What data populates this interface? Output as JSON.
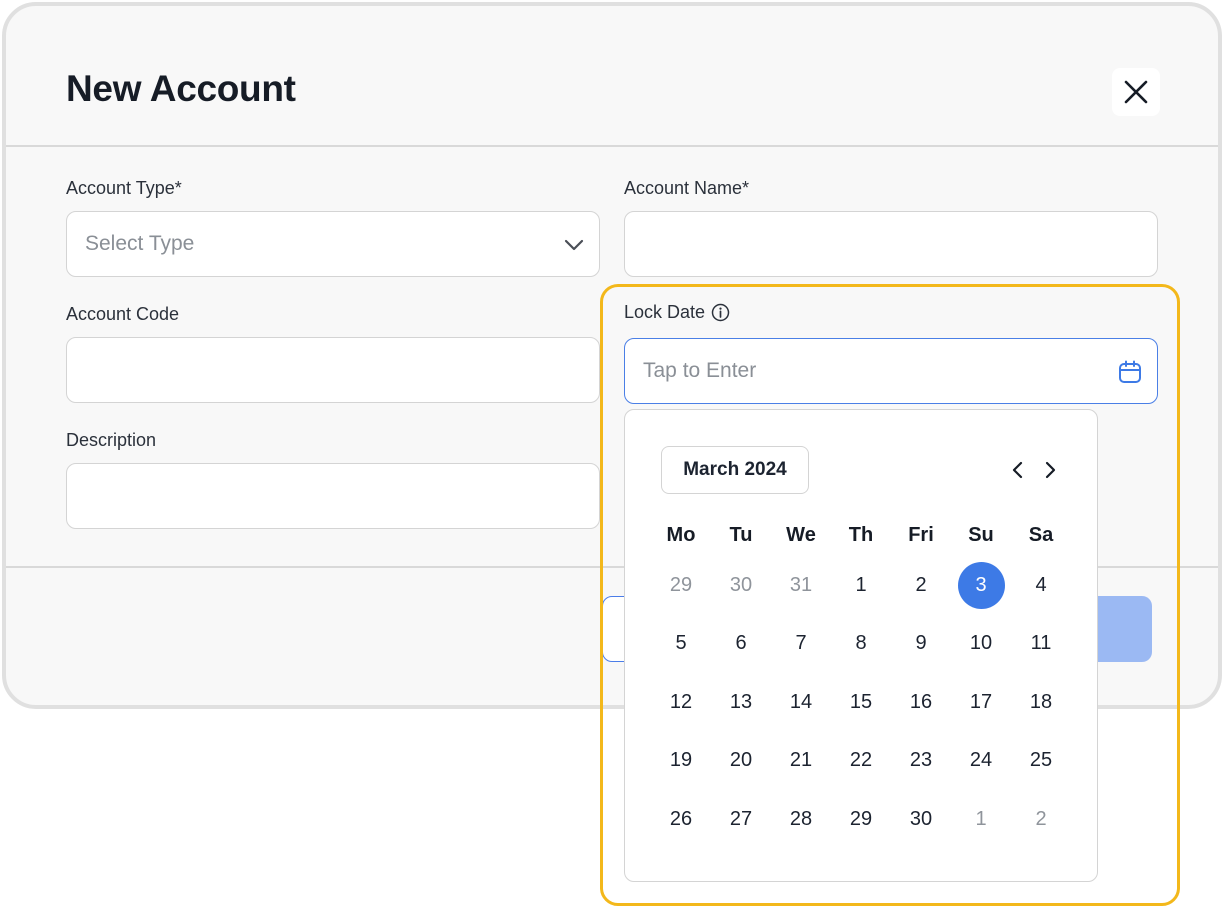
{
  "dialog": {
    "title": "New Account",
    "close_icon": "close-icon"
  },
  "form": {
    "account_type": {
      "label": "Account Type*",
      "placeholder": "Select Type",
      "icon": "chevron-down-icon"
    },
    "account_name": {
      "label": "Account Name*",
      "value": ""
    },
    "account_code": {
      "label": "Account Code",
      "value": ""
    },
    "description": {
      "label": "Description",
      "value": ""
    },
    "lock_date": {
      "label": "Lock Date",
      "info_icon": "info-icon",
      "placeholder": "Tap to Enter",
      "icon": "calendar-icon"
    }
  },
  "calendar": {
    "month_label": "March 2024",
    "prev_icon": "chevron-left-icon",
    "next_icon": "chevron-right-icon",
    "weekdays": [
      "Mo",
      "Tu",
      "We",
      "Th",
      "Fri",
      "Su",
      "Sa"
    ],
    "weeks": [
      [
        {
          "d": "29",
          "m": true
        },
        {
          "d": "30",
          "m": true
        },
        {
          "d": "31",
          "m": true
        },
        {
          "d": "1"
        },
        {
          "d": "2"
        },
        {
          "d": "3",
          "s": true
        },
        {
          "d": "4"
        }
      ],
      [
        {
          "d": "5"
        },
        {
          "d": "6"
        },
        {
          "d": "7"
        },
        {
          "d": "8"
        },
        {
          "d": "9"
        },
        {
          "d": "10"
        },
        {
          "d": "11"
        }
      ],
      [
        {
          "d": "12"
        },
        {
          "d": "13"
        },
        {
          "d": "14"
        },
        {
          "d": "15"
        },
        {
          "d": "16"
        },
        {
          "d": "17"
        },
        {
          "d": "18"
        }
      ],
      [
        {
          "d": "19"
        },
        {
          "d": "20"
        },
        {
          "d": "21"
        },
        {
          "d": "22"
        },
        {
          "d": "23"
        },
        {
          "d": "24"
        },
        {
          "d": "25"
        }
      ],
      [
        {
          "d": "26"
        },
        {
          "d": "27"
        },
        {
          "d": "28"
        },
        {
          "d": "29"
        },
        {
          "d": "30"
        },
        {
          "d": "1",
          "m": true
        },
        {
          "d": "2",
          "m": true
        }
      ]
    ],
    "selected_day": "3"
  },
  "colors": {
    "accent": "#3d7ae6",
    "highlight": "#f3b81b",
    "primary_button_disabled": "#9bb9f3"
  }
}
